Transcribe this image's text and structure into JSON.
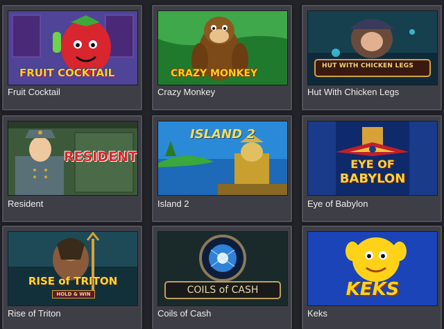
{
  "games": [
    {
      "title": "Fruit Cocktail",
      "logo": "FRUIT COCKTAIL"
    },
    {
      "title": "Crazy Monkey",
      "logo": "CRAZY MONKEY"
    },
    {
      "title": "Hut With Chicken Legs",
      "logo": "HUT WITH CHICKEN LEGS"
    },
    {
      "title": "Resident",
      "logo": "RESIDENT"
    },
    {
      "title": "Island 2",
      "logo": "ISLAND 2"
    },
    {
      "title": "Eye of Babylon",
      "logo_line1": "EYE OF",
      "logo_line2": "BABYLON"
    },
    {
      "title": "Rise of Triton",
      "logo": "RISE of TRITON",
      "badge": "HOLD & WIN"
    },
    {
      "title": "Coils of Cash",
      "logo": "COILS of CASH"
    },
    {
      "title": "Keks",
      "logo": "KEKS"
    }
  ],
  "colors": {
    "page_background": "#23232a",
    "card_background": "#3e3e46",
    "caption_text": "#eeeeee"
  }
}
